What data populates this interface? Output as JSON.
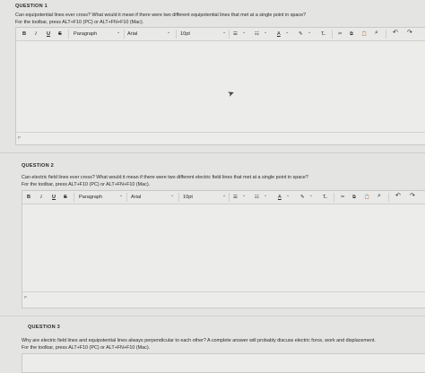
{
  "q1": {
    "title": "QUESTION 1",
    "prompt": "Can equipotential lines ever cross? What would it mean if there were two different equipotential lines that met at a single point in space?",
    "toolbar_hint": "For the toolbar, press ALT+F10 (PC) or ALT+FN+F10 (Mac).",
    "paragraph_mark": "P"
  },
  "q2": {
    "title": "QUESTION 2",
    "prompt": "Can electric field lines ever cross? What would it mean if there were two different electric field lines that met at a single point in space?",
    "toolbar_hint": "For the toolbar, press ALT+F10 (PC) or ALT+FN+F10 (Mac).",
    "paragraph_mark": "P"
  },
  "q3": {
    "title": "QUESTION 3",
    "prompt": "Why are electric field lines and equipotential lines always perpendicular to each other? A complete answer will probably discuss electric force, work and displacement.",
    "toolbar_hint": "For the toolbar, press ALT+F10 (PC) or ALT+FN+F10 (Mac)."
  },
  "toolbar": {
    "bold": "B",
    "italic": "I",
    "underline": "U",
    "strike": "S",
    "paragraph": "Paragraph",
    "font": "Arial",
    "size": "10pt",
    "chevron": "⌄",
    "bullets": "☰",
    "numbers": "☷",
    "text_color": "A",
    "highlight": "✎",
    "clear": "T̶",
    "cut": "✂",
    "copy": "⧉",
    "paste": "📋",
    "search": "⌕",
    "undo": "↶",
    "redo": "↷"
  },
  "icons": [
    "bold-icon",
    "italic-icon",
    "underline-icon",
    "strikethrough-icon",
    "bullet-list-icon",
    "numbered-list-icon",
    "text-color-icon",
    "highlight-icon",
    "clear-format-icon",
    "cut-icon",
    "copy-icon",
    "paste-icon",
    "search-icon",
    "undo-icon",
    "redo-icon"
  ],
  "colors": {
    "background": "#e4e4e2",
    "editor": "#ececea",
    "border": "#c9c9c6"
  }
}
